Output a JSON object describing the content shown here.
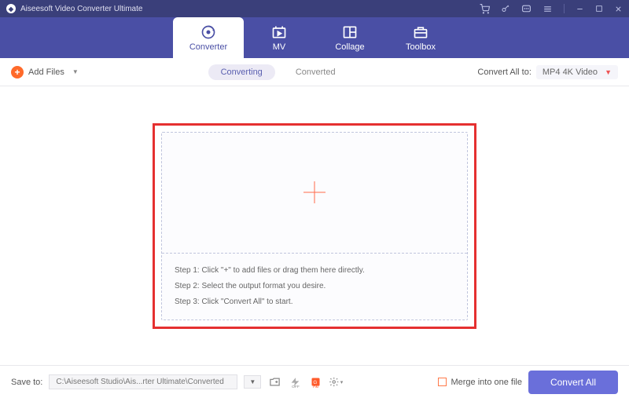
{
  "titlebar": {
    "title": "Aiseesoft Video Converter Ultimate"
  },
  "nav": {
    "tabs": [
      {
        "label": "Converter",
        "icon": "converter"
      },
      {
        "label": "MV",
        "icon": "mv"
      },
      {
        "label": "Collage",
        "icon": "collage"
      },
      {
        "label": "Toolbox",
        "icon": "toolbox"
      }
    ]
  },
  "toolbar": {
    "add_files": "Add Files",
    "sub_tabs": {
      "converting": "Converting",
      "converted": "Converted"
    },
    "convert_all_to": "Convert All to:",
    "selected_format": "MP4 4K Video"
  },
  "dropzone": {
    "step1": "Step 1: Click \"+\" to add files or drag them here directly.",
    "step2": "Step 2: Select the output format you desire.",
    "step3": "Step 3: Click \"Convert All\" to start."
  },
  "footer": {
    "save_to_label": "Save to:",
    "save_path": "C:\\Aiseesoft Studio\\Ais...rter Ultimate\\Converted",
    "merge_label": "Merge into one file",
    "convert_button": "Convert All"
  }
}
